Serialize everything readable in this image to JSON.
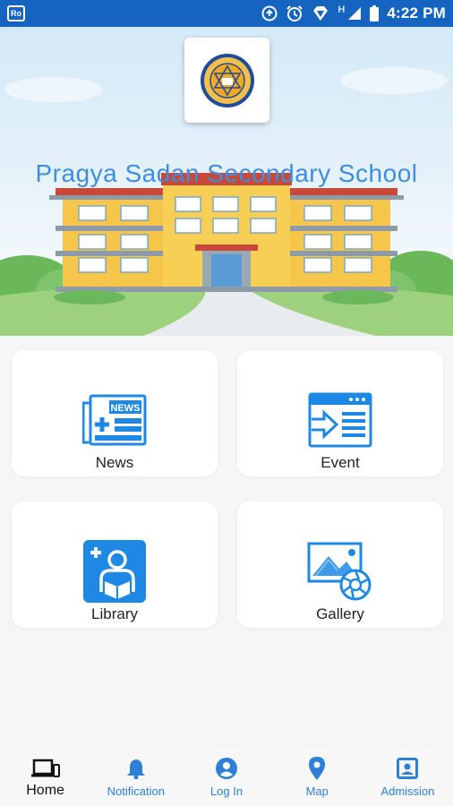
{
  "status_bar": {
    "badge": "Ro",
    "network_label": "H",
    "time": "4:22 PM"
  },
  "header": {
    "school_name": "Pragya Sadan Secondary School",
    "logo_icon": "school-emblem-icon"
  },
  "menu": [
    {
      "label": "News",
      "icon": "news-icon"
    },
    {
      "label": "Event",
      "icon": "event-icon"
    },
    {
      "label": "Library",
      "icon": "library-icon"
    },
    {
      "label": "Gallery",
      "icon": "gallery-icon"
    }
  ],
  "bottom_nav": [
    {
      "label": "Home",
      "icon": "devices-icon",
      "active": true
    },
    {
      "label": "Notification",
      "icon": "bell-icon",
      "active": false
    },
    {
      "label": "Log In",
      "icon": "account-circle-icon",
      "active": false
    },
    {
      "label": "Map",
      "icon": "map-pin-icon",
      "active": false
    },
    {
      "label": "Admission",
      "icon": "id-card-icon",
      "active": false
    }
  ],
  "colors": {
    "status_bar": "#1565c0",
    "accent_blue": "#2e7fd6",
    "title_blue": "#3d8ee0",
    "building_yellow": "#f6c64a",
    "roof_red": "#c8493a"
  }
}
